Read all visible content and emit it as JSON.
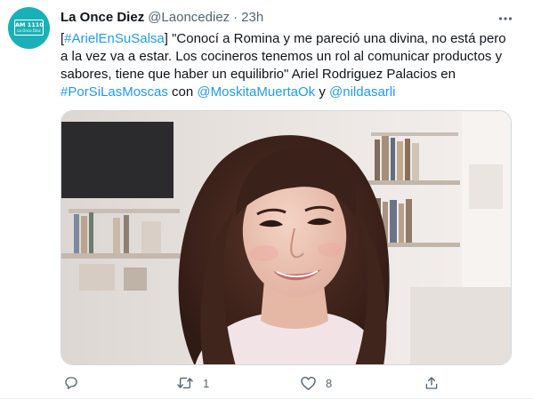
{
  "tweet": {
    "author": {
      "name": "La Once Diez",
      "handle": "@Laoncediez",
      "separator": "·",
      "time": "23h",
      "avatar_line1": "AM 1110",
      "avatar_line2": "La Once Diez"
    },
    "text": {
      "line1_hashtag": "#ArielEnSuSalsa",
      "line1_open": "[",
      "line1_rest": "] \"Conocí a Romina y me pareció una divina, no está pero",
      "line2": "a la vez va a estar. Los cocineros tenemos un rol al comunicar productos y",
      "line3": "sabores, tiene que haber un equilibrio\" Ariel Rodriguez Palacios en",
      "line4_hashtag": "#PorSiLasMoscas",
      "line4_con": " con ",
      "line4_mention1": "@MoskitaMuertaOk",
      "line4_y": " y ",
      "line4_mention2": "@nildasarli"
    },
    "actions": {
      "reply_icon": "comment-icon",
      "retweet_icon": "retweet-icon",
      "retweet_count": "1",
      "like_icon": "heart-icon",
      "like_count": "8",
      "share_icon": "share-icon"
    },
    "colors": {
      "link": "#1d9bf0",
      "secondary_text": "#536471",
      "avatar_bg": "#1ab0b7"
    }
  }
}
